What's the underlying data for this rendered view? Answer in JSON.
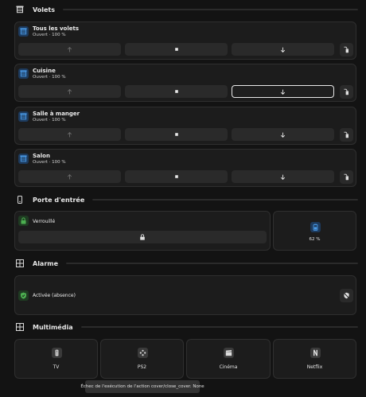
{
  "sections": {
    "volets": {
      "title": "Volets",
      "icon": "blinds-icon"
    },
    "porte": {
      "title": "Porte d'entrée",
      "icon": "phone-door-icon"
    },
    "alarme": {
      "title": "Alarme",
      "icon": "grid-icon"
    },
    "multimedia": {
      "title": "Multimédia",
      "icon": "grid-icon"
    }
  },
  "covers": [
    {
      "name": "Tous les volets",
      "state": "Ouvert · 100 %",
      "icon": "blinds-icon"
    },
    {
      "name": "Cuisine",
      "state": "Ouvert · 100 %",
      "icon": "blinds-icon"
    },
    {
      "name": "Salle à manger",
      "state": "Ouvert · 100 %",
      "icon": "blinds-icon"
    },
    {
      "name": "Salon",
      "state": "Ouvert · 100 %",
      "icon": "blinds-icon"
    }
  ],
  "controls": {
    "up": "arrow-up-icon",
    "stop": "stop-icon",
    "down": "arrow-down-icon",
    "tilt": "tilt-icon"
  },
  "lock": {
    "state": "Verrouillé",
    "icon": "lock-icon"
  },
  "battery": {
    "value": "62 %",
    "level": 0.62,
    "icon": "battery-icon"
  },
  "alarm": {
    "state": "Activée (absence)",
    "icon": "shield-icon"
  },
  "media": [
    {
      "label": "TV",
      "icon": "tv-remote-icon"
    },
    {
      "label": "PS2",
      "icon": "gamepad-icon"
    },
    {
      "label": "Cinéma",
      "icon": "clapper-icon"
    },
    {
      "label": "Netflix",
      "icon": "netflix-icon"
    }
  ],
  "toast": "Échec de l'exécution de l'action cover/close_cover. None",
  "colors": {
    "accent_blue": "#4a9be8",
    "accent_green": "#4caf50",
    "background": "#131313",
    "card": "#1c1c1c"
  }
}
